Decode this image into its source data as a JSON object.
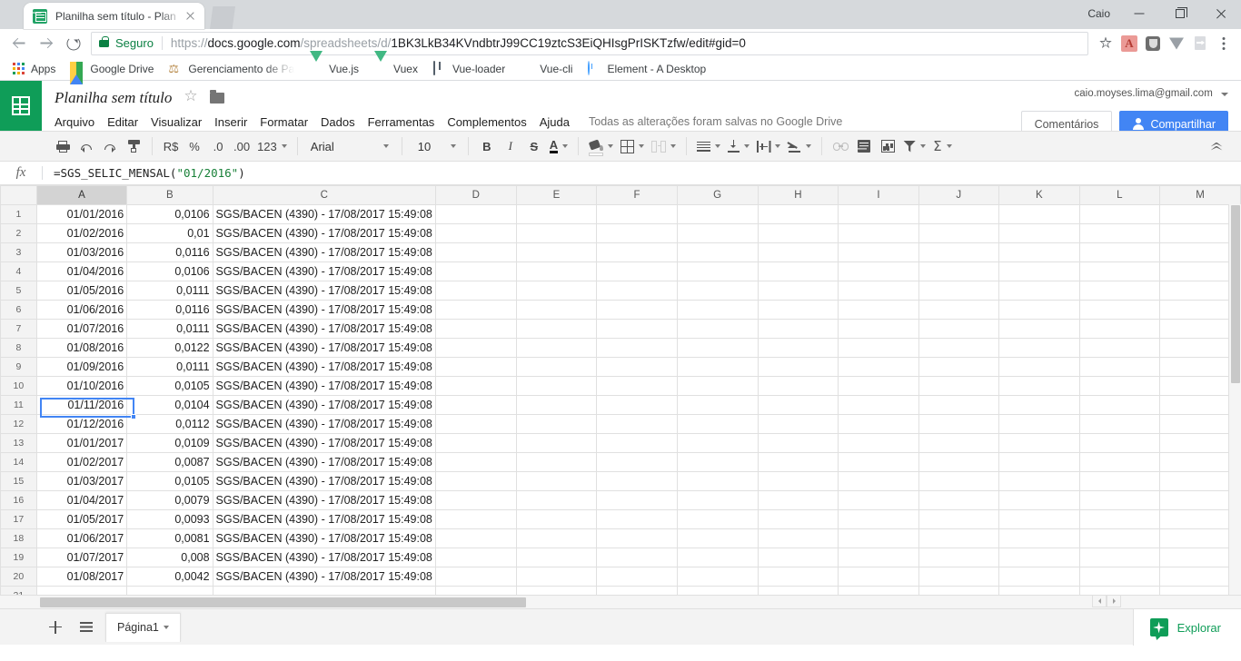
{
  "browser": {
    "tab_title": "Planilha sem título - Plan",
    "profile_name": "Caio",
    "security_label": "Seguro",
    "url_scheme": "https://",
    "url_domain": "docs.google.com",
    "url_path": "/spreadsheets/d/",
    "url_docid": "1BK3LkB34KVndbtrJ99CC19ztcS3EiQHIsgPrISKTzfw",
    "url_tail": "/edit#gid=0",
    "bookmarks": [
      {
        "label": "Apps",
        "icon": "apps-grid-icon"
      },
      {
        "label": "Google Drive",
        "icon": "google-drive-icon"
      },
      {
        "label": "Gerenciamento de Pa",
        "icon": "scales-icon"
      },
      {
        "label": "Vue.js",
        "icon": "vue-icon"
      },
      {
        "label": "Vuex",
        "icon": "vue-icon"
      },
      {
        "label": "Vue-loader",
        "icon": "book-icon"
      },
      {
        "label": "Vue-cli",
        "icon": "github-icon"
      },
      {
        "label": "Element - A Desktop",
        "icon": "element-icon"
      }
    ],
    "omnibox_icons": [
      "star-icon",
      "adobe-pdf-extension-icon",
      "shield-extension-icon",
      "vue-devtools-icon",
      "page-share-icon",
      "chrome-menu-icon"
    ]
  },
  "sheets": {
    "doc_title": "Planilha sem título",
    "account_email": "caio.moyses.lima@gmail.com",
    "save_status": "Todas as alterações foram salvas no Google Drive",
    "menus": [
      "Arquivo",
      "Editar",
      "Visualizar",
      "Inserir",
      "Formatar",
      "Dados",
      "Ferramentas",
      "Complementos",
      "Ajuda"
    ],
    "comments_label": "Comentários",
    "share_label": "Compartilhar",
    "toolbar": {
      "currency_label": "R$",
      "percent_label": "%",
      "dec_less_label": ".0",
      "dec_more_label": ".00",
      "format_label": "123",
      "font_name": "Arial",
      "font_size": "10",
      "bold_label": "B",
      "italic_label": "I",
      "strike_label": "S",
      "textcolor_label": "A",
      "sigma_label": "Σ"
    },
    "formula_bar": {
      "fx_label": "fx",
      "formula_prefix": "=SGS_SELIC_MENSAL(",
      "formula_string": "\"01/2016\"",
      "formula_suffix": ")"
    },
    "grid": {
      "columns": [
        "A",
        "B",
        "C",
        "D",
        "E",
        "F",
        "G",
        "H",
        "I",
        "J",
        "K",
        "L",
        "M"
      ],
      "selected_column": "A",
      "selected_cell": "A1",
      "row_count_visible": 21,
      "rows": [
        {
          "n": "1",
          "a": "01/01/2016",
          "b": "0,0106",
          "c": "SGS/BACEN (4390) - 17/08/2017 15:49:08"
        },
        {
          "n": "2",
          "a": "01/02/2016",
          "b": "0,01",
          "c": "SGS/BACEN (4390) - 17/08/2017 15:49:08"
        },
        {
          "n": "3",
          "a": "01/03/2016",
          "b": "0,0116",
          "c": "SGS/BACEN (4390) - 17/08/2017 15:49:08"
        },
        {
          "n": "4",
          "a": "01/04/2016",
          "b": "0,0106",
          "c": "SGS/BACEN (4390) - 17/08/2017 15:49:08"
        },
        {
          "n": "5",
          "a": "01/05/2016",
          "b": "0,0111",
          "c": "SGS/BACEN (4390) - 17/08/2017 15:49:08"
        },
        {
          "n": "6",
          "a": "01/06/2016",
          "b": "0,0116",
          "c": "SGS/BACEN (4390) - 17/08/2017 15:49:08"
        },
        {
          "n": "7",
          "a": "01/07/2016",
          "b": "0,0111",
          "c": "SGS/BACEN (4390) - 17/08/2017 15:49:08"
        },
        {
          "n": "8",
          "a": "01/08/2016",
          "b": "0,0122",
          "c": "SGS/BACEN (4390) - 17/08/2017 15:49:08"
        },
        {
          "n": "9",
          "a": "01/09/2016",
          "b": "0,0111",
          "c": "SGS/BACEN (4390) - 17/08/2017 15:49:08"
        },
        {
          "n": "10",
          "a": "01/10/2016",
          "b": "0,0105",
          "c": "SGS/BACEN (4390) - 17/08/2017 15:49:08"
        },
        {
          "n": "11",
          "a": "01/11/2016",
          "b": "0,0104",
          "c": "SGS/BACEN (4390) - 17/08/2017 15:49:08"
        },
        {
          "n": "12",
          "a": "01/12/2016",
          "b": "0,0112",
          "c": "SGS/BACEN (4390) - 17/08/2017 15:49:08"
        },
        {
          "n": "13",
          "a": "01/01/2017",
          "b": "0,0109",
          "c": "SGS/BACEN (4390) - 17/08/2017 15:49:08"
        },
        {
          "n": "14",
          "a": "01/02/2017",
          "b": "0,0087",
          "c": "SGS/BACEN (4390) - 17/08/2017 15:49:08"
        },
        {
          "n": "15",
          "a": "01/03/2017",
          "b": "0,0105",
          "c": "SGS/BACEN (4390) - 17/08/2017 15:49:08"
        },
        {
          "n": "16",
          "a": "01/04/2017",
          "b": "0,0079",
          "c": "SGS/BACEN (4390) - 17/08/2017 15:49:08"
        },
        {
          "n": "17",
          "a": "01/05/2017",
          "b": "0,0093",
          "c": "SGS/BACEN (4390) - 17/08/2017 15:49:08"
        },
        {
          "n": "18",
          "a": "01/06/2017",
          "b": "0,0081",
          "c": "SGS/BACEN (4390) - 17/08/2017 15:49:08"
        },
        {
          "n": "19",
          "a": "01/07/2017",
          "b": "0,008",
          "c": "SGS/BACEN (4390) - 17/08/2017 15:49:08"
        },
        {
          "n": "20",
          "a": "01/08/2017",
          "b": "0,0042",
          "c": "SGS/BACEN (4390) - 17/08/2017 15:49:08"
        },
        {
          "n": "21",
          "a": "",
          "b": "",
          "c": ""
        }
      ]
    },
    "sheet_tabs": [
      {
        "name": "Página1"
      }
    ],
    "explore_label": "Explorar"
  },
  "colors": {
    "sheets_green": "#0f9d58",
    "share_blue": "#4285f4",
    "selection_blue": "#4285f4",
    "secure_green": "#0b8043",
    "formula_string_green": "#188038"
  }
}
